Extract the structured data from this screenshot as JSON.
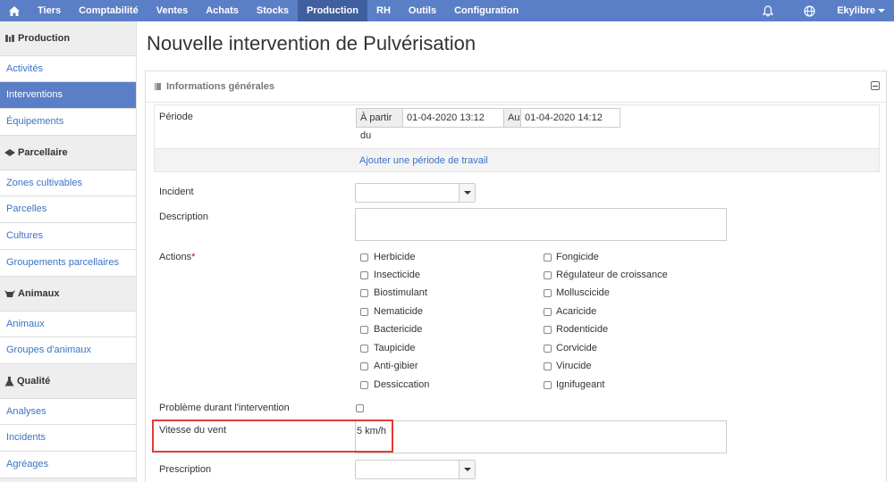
{
  "topnav": {
    "items": [
      "Tiers",
      "Comptabilité",
      "Ventes",
      "Achats",
      "Stocks",
      "Production",
      "RH",
      "Outils",
      "Configuration"
    ],
    "active": "Production",
    "user": "Ekylibre",
    "home_icon": "home-icon",
    "bell_icon": "bell-icon",
    "globe_icon": "globe-icon"
  },
  "sidebar": {
    "production": {
      "title": "Production",
      "items": [
        "Activités",
        "Interventions",
        "Équipements"
      ]
    },
    "parcellaire": {
      "title": "Parcellaire",
      "items": [
        "Zones cultivables",
        "Parcelles",
        "Cultures",
        "Groupements parcellaires"
      ]
    },
    "animaux": {
      "title": "Animaux",
      "items": [
        "Animaux",
        "Groupes d'animaux"
      ]
    },
    "qualite": {
      "title": "Qualité",
      "items": [
        "Analyses",
        "Incidents",
        "Agréages"
      ]
    }
  },
  "page": {
    "title": "Nouvelle intervention de Pulvérisation"
  },
  "panel": {
    "heading": "Informations générales",
    "periode_label": "Période",
    "from_label": "À partir du",
    "from_value": "01-04-2020 13:12",
    "to_label": "Au",
    "to_value": "01-04-2020 14:12",
    "add_period": "Ajouter une période de travail",
    "incident_label": "Incident",
    "description_label": "Description",
    "actions_label": "Actions",
    "actions_required": "*",
    "actions_left": [
      "Herbicide",
      "Insecticide",
      "Biostimulant",
      "Nematicide",
      "Bactericide",
      "Taupicide",
      "Anti-gibier",
      "Dessiccation"
    ],
    "actions_right": [
      "Fongicide",
      "Régulateur de croissance",
      "Molluscicide",
      "Acaricide",
      "Rodenticide",
      "Corvicide",
      "Virucide",
      "Ignifugeant"
    ],
    "probleme_label": "Problème durant l'intervention",
    "vent_label": "Vitesse du vent",
    "vent_value": "5 km/h",
    "prescription_label": "Prescription"
  },
  "colors": {
    "nav": "#5b7fc7",
    "nav_active": "#3f5f9f",
    "link": "#3a73c6",
    "highlight": "#e53935"
  }
}
